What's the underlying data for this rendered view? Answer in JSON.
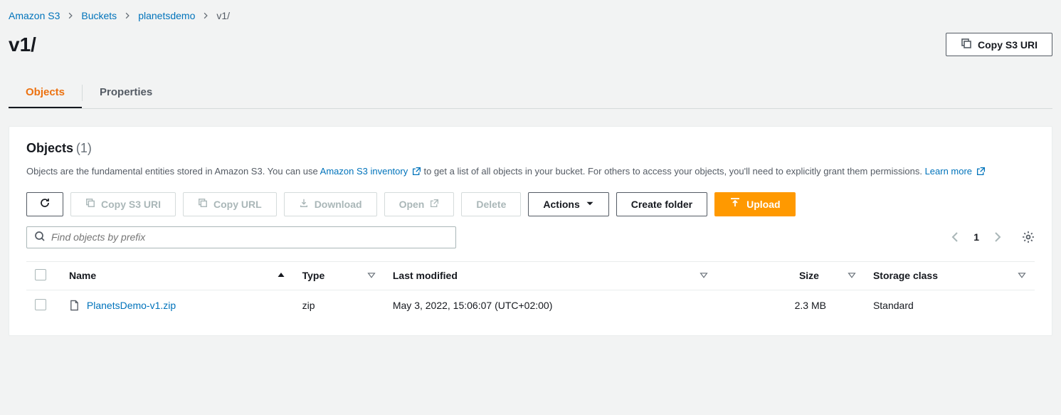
{
  "breadcrumb": {
    "items": [
      "Amazon S3",
      "Buckets",
      "planetsdemo"
    ],
    "current": "v1/"
  },
  "title": "v1/",
  "copyUriBtn": "Copy S3 URI",
  "tabs": {
    "objects": "Objects",
    "properties": "Properties"
  },
  "panel": {
    "heading": "Objects",
    "count": "(1)",
    "desc1": "Objects are the fundamental entities stored in Amazon S3. You can use ",
    "inventoryLink": "Amazon S3 inventory",
    "desc2": " to get a list of all objects in your bucket. For others to access your objects, you'll need to explicitly grant them permissions. ",
    "learnMore": "Learn more"
  },
  "toolbar": {
    "copyS3Uri": "Copy S3 URI",
    "copyUrl": "Copy URL",
    "download": "Download",
    "open": "Open",
    "delete": "Delete",
    "actions": "Actions",
    "createFolder": "Create folder",
    "upload": "Upload"
  },
  "search": {
    "placeholder": "Find objects by prefix"
  },
  "pager": {
    "page": "1"
  },
  "columns": {
    "name": "Name",
    "type": "Type",
    "lastModified": "Last modified",
    "size": "Size",
    "storageClass": "Storage class"
  },
  "rows": [
    {
      "name": "PlanetsDemo-v1.zip",
      "type": "zip",
      "lastModified": "May 3, 2022, 15:06:07 (UTC+02:00)",
      "size": "2.3 MB",
      "storageClass": "Standard"
    }
  ]
}
